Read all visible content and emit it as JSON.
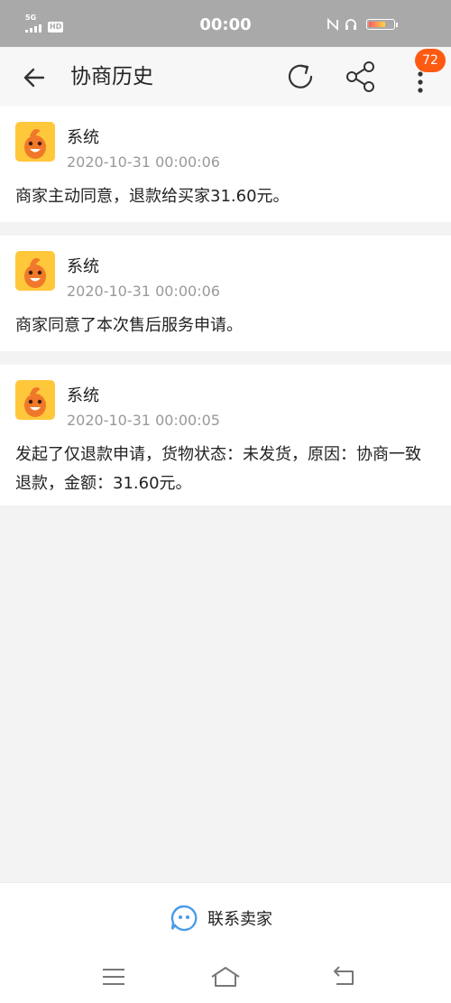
{
  "status_bar": {
    "network": "5G",
    "hd": "HD",
    "time": "00:00"
  },
  "header": {
    "title": "协商历史",
    "badge_count": "72"
  },
  "messages": [
    {
      "sender": "系统",
      "time": "2020-10-31 00:00:06",
      "text": "商家主动同意，退款给买家31.60元。"
    },
    {
      "sender": "系统",
      "time": "2020-10-31 00:00:06",
      "text": "商家同意了本次售后服务申请。"
    },
    {
      "sender": "系统",
      "time": "2020-10-31 00:00:05",
      "text": "发起了仅退款申请，货物状态：未发货，原因：协商一致退款，金额：31.60元。"
    }
  ],
  "footer": {
    "contact_label": "联系卖家"
  },
  "colors": {
    "accent": "#ff5a12",
    "avatar_bg": "#ffc73a",
    "contact_icon": "#4a9be8"
  },
  "icons": {
    "back": "back-arrow-icon",
    "refresh": "refresh-icon",
    "share": "share-icon",
    "more": "more-vertical-icon",
    "avatar": "mascot-icon",
    "contact": "chat-bubble-icon"
  }
}
